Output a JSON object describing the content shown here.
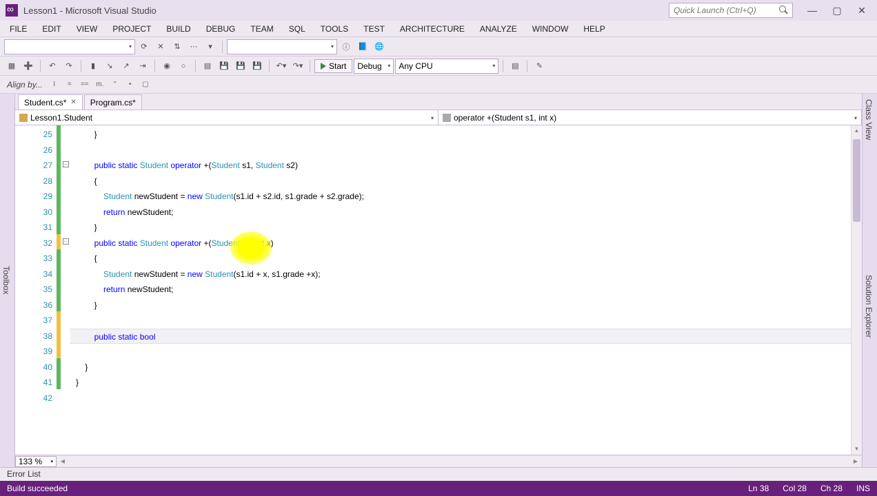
{
  "title": "Lesson1 - Microsoft Visual Studio",
  "quick_launch_placeholder": "Quick Launch (Ctrl+Q)",
  "menu": [
    "FILE",
    "EDIT",
    "VIEW",
    "PROJECT",
    "BUILD",
    "DEBUG",
    "TEAM",
    "SQL",
    "TOOLS",
    "TEST",
    "ARCHITECTURE",
    "ANALYZE",
    "WINDOW",
    "HELP"
  ],
  "toolbar2": {
    "start": "Start",
    "config": "Debug",
    "platform": "Any CPU"
  },
  "align_bar": {
    "label": "Align by..."
  },
  "side_tabs": {
    "left": "Toolbox",
    "right1": "Class View",
    "right2": "Solution Explorer"
  },
  "file_tabs": [
    {
      "name": "Student.cs*",
      "active": true
    },
    {
      "name": "Program.cs*",
      "active": false
    }
  ],
  "nav": {
    "class": "Lesson1.Student",
    "member": "operator +(Student s1, int x)"
  },
  "lines": {
    "start": 25,
    "end": 42,
    "changes": [
      "green",
      "green",
      "green",
      "green",
      "green",
      "green",
      "green",
      "yellow",
      "green",
      "green",
      "green",
      "green",
      "yellow",
      "yellow",
      "yellow",
      "green",
      "green",
      "none"
    ],
    "folds": {
      "27": "-",
      "32": "-"
    }
  },
  "zoom": "133 %",
  "error_tab": "Error List",
  "status": {
    "build": "Build succeeded",
    "line": "Ln 38",
    "col": "Col 28",
    "ch": "Ch 28",
    "ins": "INS"
  }
}
